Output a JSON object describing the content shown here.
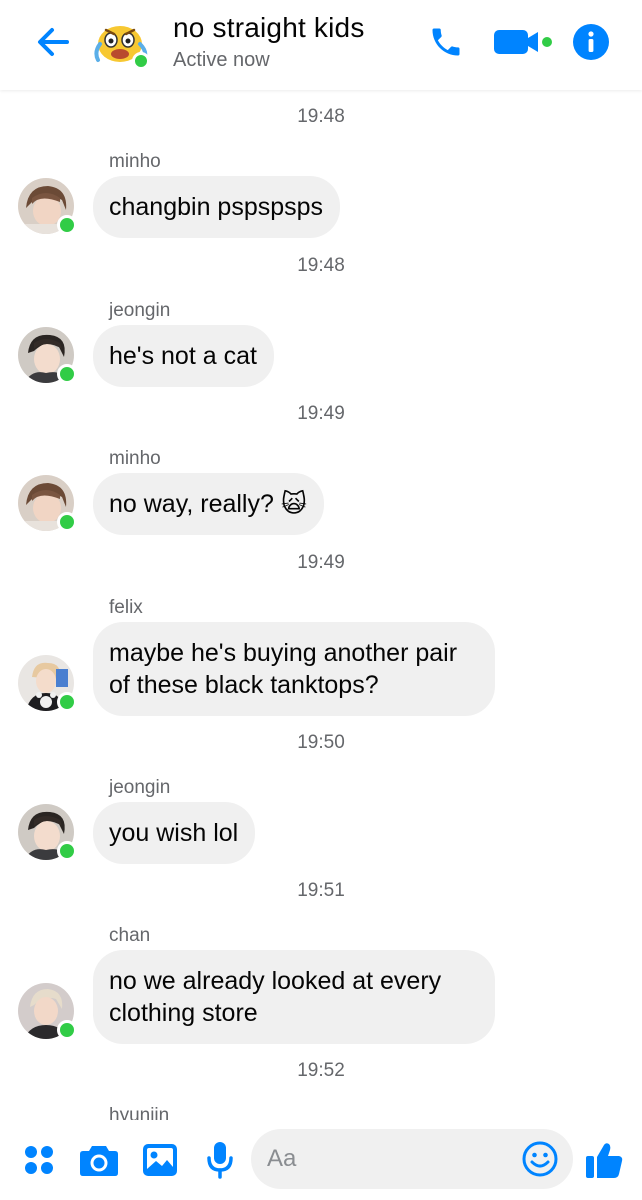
{
  "header": {
    "title": "no straight kids",
    "status": "Active now"
  },
  "colors": {
    "accent": "#0084ff",
    "online": "#31cc46",
    "bubble": "#f0f0f0",
    "meta_text": "#65676b"
  },
  "icons": {
    "back": "arrow-left-icon",
    "call": "phone-icon",
    "video": "video-camera-icon",
    "info": "info-icon",
    "more": "four-dots-icon",
    "camera": "camera-icon",
    "gallery": "image-icon",
    "mic": "microphone-icon",
    "emoji": "smiley-icon",
    "like": "thumbs-up-icon"
  },
  "messages": [
    {
      "time": "19:48",
      "sender": "minho",
      "text": "changbin pspspsps"
    },
    {
      "time": "19:48",
      "sender": "jeongin",
      "text": "he's not a cat"
    },
    {
      "time": "19:49",
      "sender": "minho",
      "text": "no way, really? 🙀"
    },
    {
      "time": "19:49",
      "sender": "felix",
      "text": "maybe he's buying another pair of these black tanktops?"
    },
    {
      "time": "19:50",
      "sender": "jeongin",
      "text": "you wish lol"
    },
    {
      "time": "19:51",
      "sender": "chan",
      "text": "no we already looked at every clothing store"
    },
    {
      "time": "19:52",
      "sender": "hyunjin",
      "text": ""
    }
  ],
  "composer": {
    "placeholder": "Aa",
    "value": ""
  }
}
